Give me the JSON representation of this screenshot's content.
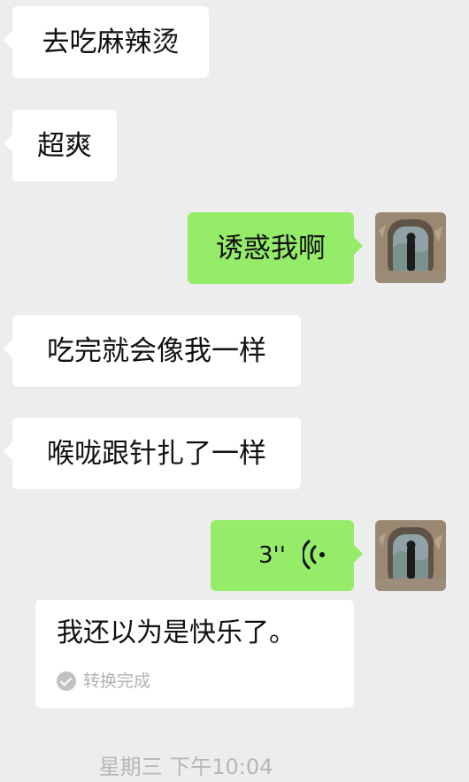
{
  "messages": [
    {
      "side": "in",
      "text": "去吃麻辣烫"
    },
    {
      "side": "in",
      "text": "超爽"
    },
    {
      "side": "out",
      "text": "诱惑我啊"
    },
    {
      "side": "in",
      "text": "吃完就会像我一样"
    },
    {
      "side": "in",
      "text": "喉咙跟针扎了一样"
    }
  ],
  "voice": {
    "duration": "3''",
    "transcript": "我还以为是快乐了。",
    "status": "转换完成"
  },
  "timestamp": "星期三 下午10:04",
  "colors": {
    "background": "#ededed",
    "incoming_bubble": "#ffffff",
    "outgoing_bubble": "#95ec69"
  }
}
